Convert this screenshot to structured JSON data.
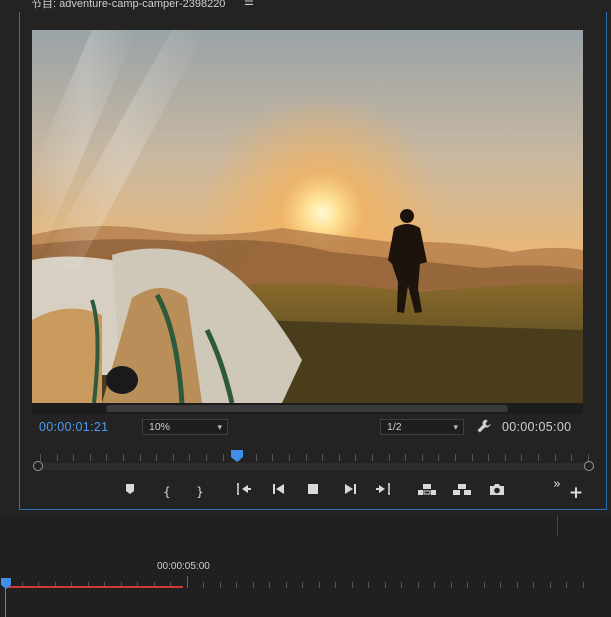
{
  "panel": {
    "title": "节目: adventure-camp-camper-2398220",
    "menu_icon": "hamburger-menu-icon"
  },
  "preview": {
    "image": "sunset-camping-tent-hiker-photo"
  },
  "timecode": {
    "current": "00:00:01:21",
    "duration": "00:00:05:00"
  },
  "zoom_select": {
    "value": "10%"
  },
  "resolution_select": {
    "value": "1/2"
  },
  "controls": {
    "marker": "add-marker-icon",
    "mark_in": "{",
    "mark_out": "}",
    "go_in": "go-to-in-icon",
    "step_back": "step-back-icon",
    "stop": "stop-icon",
    "step_forward": "step-forward-icon",
    "go_out": "go-to-out-icon",
    "lift": "lift-icon",
    "extract": "extract-icon",
    "export_frame": "camera-icon",
    "more": "»",
    "add": "+"
  },
  "timeline": {
    "ruler_label": "00:00:05:00"
  },
  "colors": {
    "accent": "#2f6fb7",
    "timecode_blue": "#4c9bf0",
    "playhead": "#3f8ee8",
    "in_out_bar": "#d23a3a"
  }
}
